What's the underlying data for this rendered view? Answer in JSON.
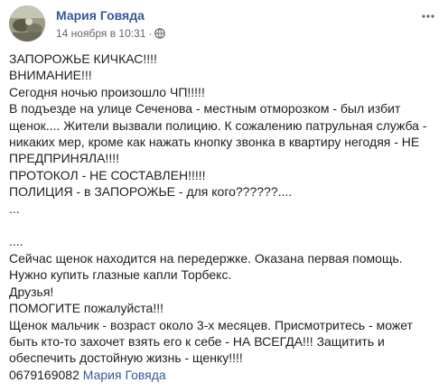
{
  "post": {
    "author": "Мария Говяда",
    "timestamp": "14 ноября в 10:31",
    "separator": "·",
    "privacy_icon": "globe-icon",
    "more_icon": "more-options-icon",
    "lines": [
      "ЗАПОРОЖЬЕ КИЧКАС!!!!",
      "ВНИМАНИЕ!!!",
      "Сегодня ночью произошло ЧП!!!!!",
      "В подъезде на улице Сеченова - местным отморозком - был избит",
      "щенок.... Жители вызвали полицию. К сожалению патрульная служба -",
      "никаких мер, кроме как нажать кнопку звонка в квартиру негодяя - НЕ",
      "ПРЕДПРИНЯЛА!!!!",
      "ПРОТОКОЛ - НЕ СОСТАВЛЕН!!!!!",
      "ПОЛИЦИЯ - в ЗАПОРОЖЬЕ - для кого??????....",
      "...",
      "",
      "....",
      "Сейчас щенок находится на передержке. Оказана первая помощь.",
      "Нужно купить глазные капли Торбекс.",
      "Друзья!",
      "ПОМОГИТЕ пожалуйста!!!",
      "Щенок мальчик - возраст около 3-х месяцев. Присмотритесь - может",
      "быть кто-то захочет взять его к себе - НА ВСЕГДА!!! Защитить и",
      "обеспечить достойную жизнь - щенку!!!!"
    ],
    "phone": "0679169082",
    "mention": "Мария Говяда"
  },
  "colors": {
    "link": "#385898",
    "text": "#1c1e21",
    "meta": "#616770"
  }
}
